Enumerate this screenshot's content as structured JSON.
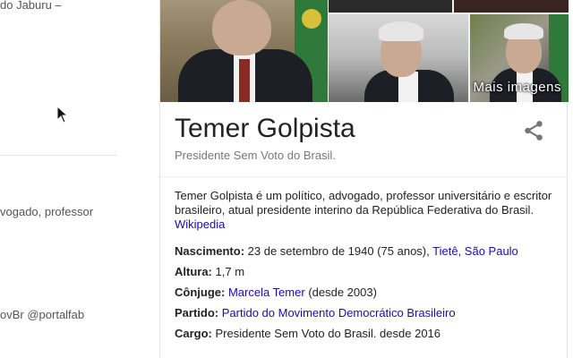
{
  "left_results": {
    "snippet_1": "do Jaburu –",
    "snippet_2": "vogado, professor",
    "snippet_3": "ovBr @portalfab"
  },
  "panel": {
    "more_images_label": "Mais imagens",
    "title": "Temer Golpista",
    "subtitle": "Presidente Sem Voto do Brasil.",
    "description": "Temer Golpista é um político, advogado, professor universitário e escritor brasileiro, atual presidente interino da República Federativa do Brasil.",
    "description_source": "Wikipedia",
    "facts": {
      "birth": {
        "label": "Nascimento:",
        "value": "23 de setembro de 1940 (75 anos),",
        "place_1": "Tietê",
        "place_sep": ", ",
        "place_2": "São Paulo"
      },
      "height": {
        "label": "Altura:",
        "value": "1,7 m"
      },
      "spouse": {
        "label": "Cônjuge:",
        "link": "Marcela Temer",
        "value": "(desde 2003)"
      },
      "party": {
        "label": "Partido:",
        "link": "Partido do Movimento Democrático Brasileiro"
      },
      "office": {
        "label": "Cargo:",
        "value": "Presidente Sem Voto do Brasil. desde 2016"
      }
    },
    "icons": {
      "share": "share-icon",
      "cursor": "mouse-pointer-icon"
    },
    "colors": {
      "link": "#1a0dab",
      "subtitle": "#777777",
      "text": "#222222"
    }
  }
}
